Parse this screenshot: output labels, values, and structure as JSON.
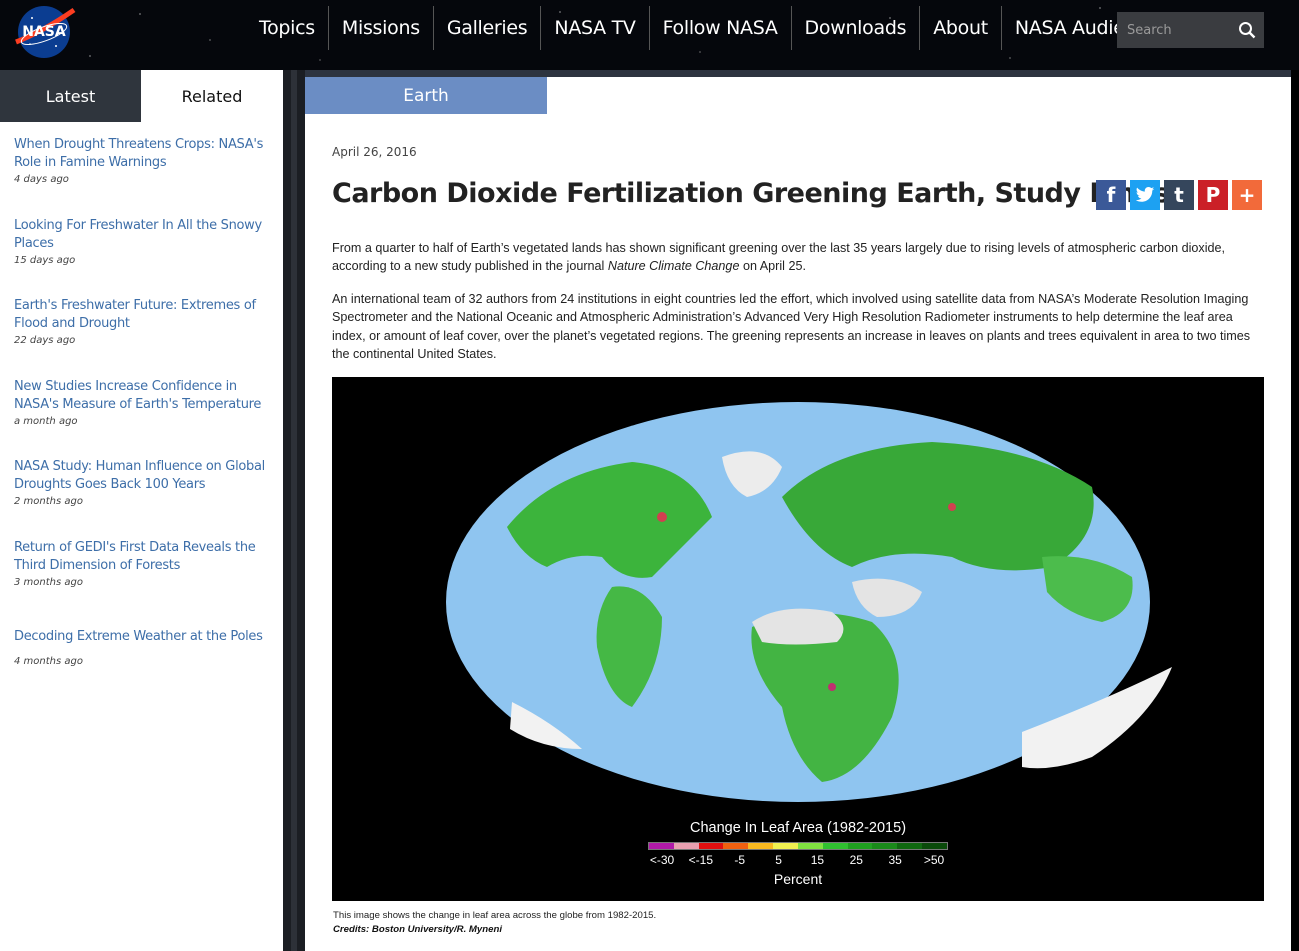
{
  "header": {
    "logo_text": "NASA",
    "nav": [
      "Topics",
      "Missions",
      "Galleries",
      "NASA TV",
      "Follow NASA",
      "Downloads",
      "About",
      "NASA Audiences"
    ],
    "search_placeholder": "Search"
  },
  "sidebar": {
    "tabs": {
      "latest": "Latest",
      "related": "Related"
    },
    "items": [
      {
        "title": "When Drought Threatens Crops: NASA's Role in Famine Warnings",
        "ago": "4 days ago"
      },
      {
        "title": "Looking For Freshwater In All the Snowy Places",
        "ago": "15 days ago"
      },
      {
        "title": "Earth's Freshwater Future: Extremes of Flood and Drought",
        "ago": "22 days ago"
      },
      {
        "title": "New Studies Increase Confidence in NASA's Measure of Earth's Temperature",
        "ago": "a month ago"
      },
      {
        "title": "NASA Study: Human Influence on Global Droughts Goes Back 100 Years",
        "ago": "2 months ago"
      },
      {
        "title": "Return of GEDI's First Data Reveals the Third Dimension of Forests",
        "ago": "3 months ago"
      },
      {
        "title": "Decoding Extreme Weather at the Poles",
        "ago": "4 months ago"
      }
    ]
  },
  "article": {
    "topic": "Earth",
    "date": "April 26, 2016",
    "headline": "Carbon Dioxide Fertilization Greening Earth, Study Finds",
    "p1_before": "From a quarter to half of Earth’s vegetated lands has shown significant greening over the last 35 years largely due to rising levels of atmospheric carbon dioxide, according to a new study published in the journal ",
    "p1_journal": "Nature Climate Change",
    "p1_after": " on April 25.",
    "p2": "An international team of 32 authors from 24 institutions in eight countries led the effort, which involved using satellite data from NASA’s Moderate Resolution Imaging Spectrometer and the National Oceanic and Atmospheric Administration’s Advanced Very High Resolution Radiometer instruments to help determine the leaf area index, or amount of leaf cover, over the planet’s vegetated regions. The greening represents an increase in leaves on plants and trees equivalent in area to two times the continental United States.",
    "figure": {
      "legend_title": "Change In Leaf Area (1982-2015)",
      "legend_ticks": [
        "<-30",
        "<-15",
        "-5",
        "5",
        "15",
        "25",
        "35",
        ">50"
      ],
      "legend_unit": "Percent",
      "legend_colors": [
        "#b01aa8",
        "#e8a0b0",
        "#e01010",
        "#f06010",
        "#f8b820",
        "#f0f050",
        "#80e040",
        "#30c030",
        "#20a020",
        "#1a8a1a",
        "#106810",
        "#0a4a0a"
      ]
    },
    "caption": "This image shows the change in leaf area across the globe from 1982-2015.",
    "credits": "Credits: Boston University/R. Myneni"
  }
}
